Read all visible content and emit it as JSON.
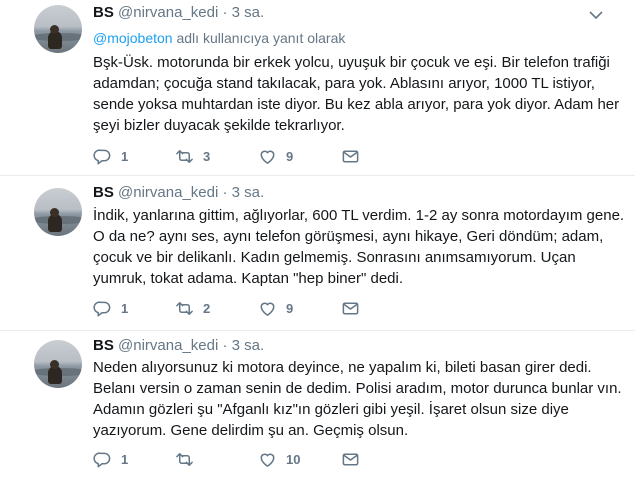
{
  "tweets": [
    {
      "name": "BS",
      "handle": "@nirvana_kedi",
      "separator": "·",
      "time": "3 sa.",
      "reply_to": {
        "mention": "@mojobeton",
        "suffix": "adlı kullanıcıya yanıt olarak"
      },
      "lines": [
        "Bşk-Üsk. motorunda bir erkek yolcu, uyuşuk bir çocuk ve eşi. Bir telefon trafiği",
        "adamdan; çocuğa stand takılacak, para yok. Ablasını arıyor, 1000 TL istiyor,",
        "sende yoksa muhtardan iste diyor. Bu kez abla arıyor, para yok diyor. Adam her",
        "şeyi bizler duyacak şekilde tekrarlıyor."
      ],
      "actions": {
        "replies": "1",
        "retweets": "3",
        "likes": "9"
      }
    },
    {
      "name": "BS",
      "handle": "@nirvana_kedi",
      "separator": "·",
      "time": "3 sa.",
      "lines": [
        "İndik, yanlarına gittim, ağlıyorlar,  600 TL verdim. 1-2 ay sonra motordayım gene.",
        "O da ne? aynı ses, aynı telefon görüşmesi, aynı hikaye, Geri döndüm; adam,",
        "çocuk ve bir delikanlı. Kadın gelmemiş. Sonrasını anımsamıyorum. Uçan",
        "yumruk, tokat adama. Kaptan \"hep biner\" dedi."
      ],
      "actions": {
        "replies": "1",
        "retweets": "2",
        "likes": "9"
      }
    },
    {
      "name": "BS",
      "handle": "@nirvana_kedi",
      "separator": "·",
      "time": "3 sa.",
      "lines": [
        "Neden alıyorsunuz ki motora deyince, ne yapalım ki,  bileti basan girer dedi.",
        "Belanı versin o zaman senin de dedim. Polisi aradım, motor durunca bunlar vın.",
        "Adamın gözleri şu \"Afganlı kız\"ın gözleri gibi yeşil. İşaret olsun size diye",
        "yazıyorum. Gene delirdim şu an. Geçmiş olsun."
      ],
      "actions": {
        "replies": "1",
        "retweets": "",
        "likes": "10"
      }
    }
  ],
  "icons": [
    "reply-icon",
    "retweet-icon",
    "like-icon",
    "direct-message-icon",
    "chevron-down-icon"
  ],
  "colors": {
    "text": "#14171a",
    "muted": "#657786",
    "link": "#1da1f2",
    "divider": "#e6ecf0"
  }
}
